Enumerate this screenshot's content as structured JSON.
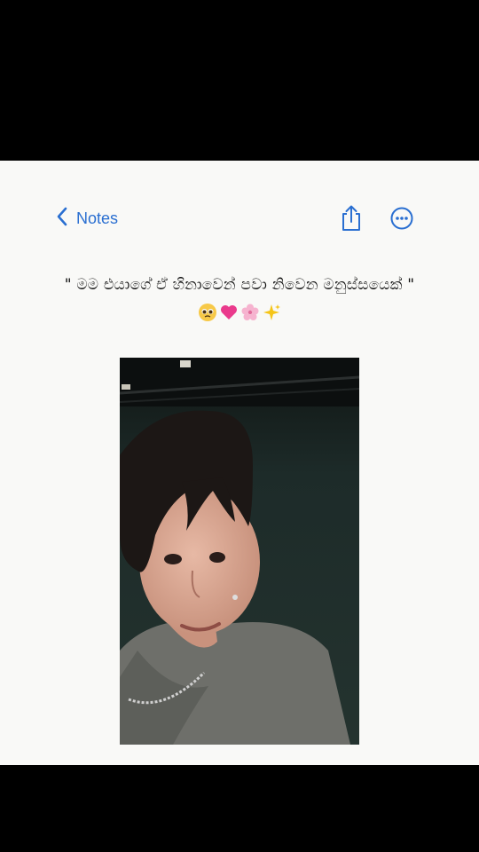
{
  "navbar": {
    "back_label": "Notes",
    "back_icon": "chevron-left-icon",
    "share_icon": "share-icon",
    "more_icon": "ellipsis-circle-icon"
  },
  "note": {
    "text": "\" මම එයාගේ ඒ හිනාවෙන් පවා නිවෙන මනුස්සයෙක් \"",
    "emojis": [
      "pleading-face",
      "pink-heart",
      "cherry-blossom",
      "sparkles"
    ]
  },
  "photo": {
    "subject": "portrait-photo"
  },
  "colors": {
    "accent": "#2a6fd1",
    "background": "#f9f9f7",
    "letterbox": "#000000"
  }
}
